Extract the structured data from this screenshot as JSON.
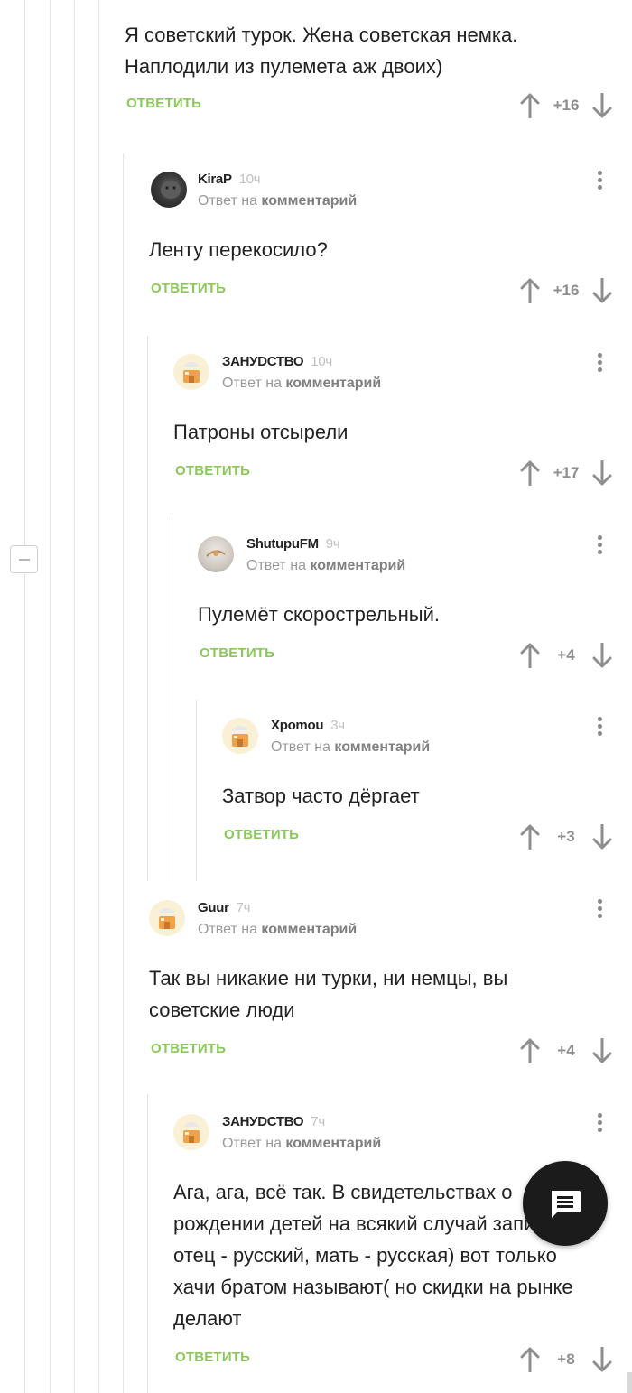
{
  "collapse_label": "−",
  "comments": [
    {
      "author": "",
      "time": "",
      "reply_prefix": "",
      "reply_link": "",
      "text": "Я советский турок. Жена советская немка. Наплодили из пулемета аж двоих)",
      "reply_label": "ОТВЕТИТЬ",
      "rating": "+16"
    },
    {
      "author": "KiraP",
      "time": "10ч",
      "reply_prefix": "Ответ на",
      "reply_link": "комментарий",
      "text": "Ленту перекосило?",
      "reply_label": "ОТВЕТИТЬ",
      "rating": "+16"
    },
    {
      "author": "ЗАНУDСТВО",
      "time": "10ч",
      "reply_prefix": "Ответ на",
      "reply_link": "комментарий",
      "text": "Патроны отсырели",
      "reply_label": "ОТВЕТИТЬ",
      "rating": "+17"
    },
    {
      "author": "ShutupuFM",
      "time": "9ч",
      "reply_prefix": "Ответ на",
      "reply_link": "комментарий",
      "text": "Пулемёт скорострельный.",
      "reply_label": "ОТВЕТИТЬ",
      "rating": "+4"
    },
    {
      "author": "Xpomou",
      "time": "3ч",
      "reply_prefix": "Ответ на",
      "reply_link": "комментарий",
      "text": "Затвор часто дёргает",
      "reply_label": "ОТВЕТИТЬ",
      "rating": "+3"
    },
    {
      "author": "Guur",
      "time": "7ч",
      "reply_prefix": "Ответ на",
      "reply_link": "комментарий",
      "text": "Так вы никакие ни турки, ни немцы, вы советские люди",
      "reply_label": "ОТВЕТИТЬ",
      "rating": "+4"
    },
    {
      "author": "ЗАНУDСТВО",
      "time": "7ч",
      "reply_prefix": "Ответ на",
      "reply_link": "комментарий",
      "text": "Ага, ага, всё так. В свидетельствах о рождении детей на всякий случай записано: отец - русский, мать - русская) вот только хачи братом называют( но скидки на рынке делают",
      "reply_label": "ОТВЕТИТЬ",
      "rating": "+8"
    }
  ],
  "colors": {
    "accent": "#8ac858",
    "thread_line": "#e3e3e3",
    "muted": "#9a9a9a",
    "fab": "#1b1b1b"
  },
  "icons": {
    "upvote": "arrow-up-icon",
    "downvote": "arrow-down-icon",
    "more": "more-vertical-icon",
    "fab": "comment-icon"
  }
}
